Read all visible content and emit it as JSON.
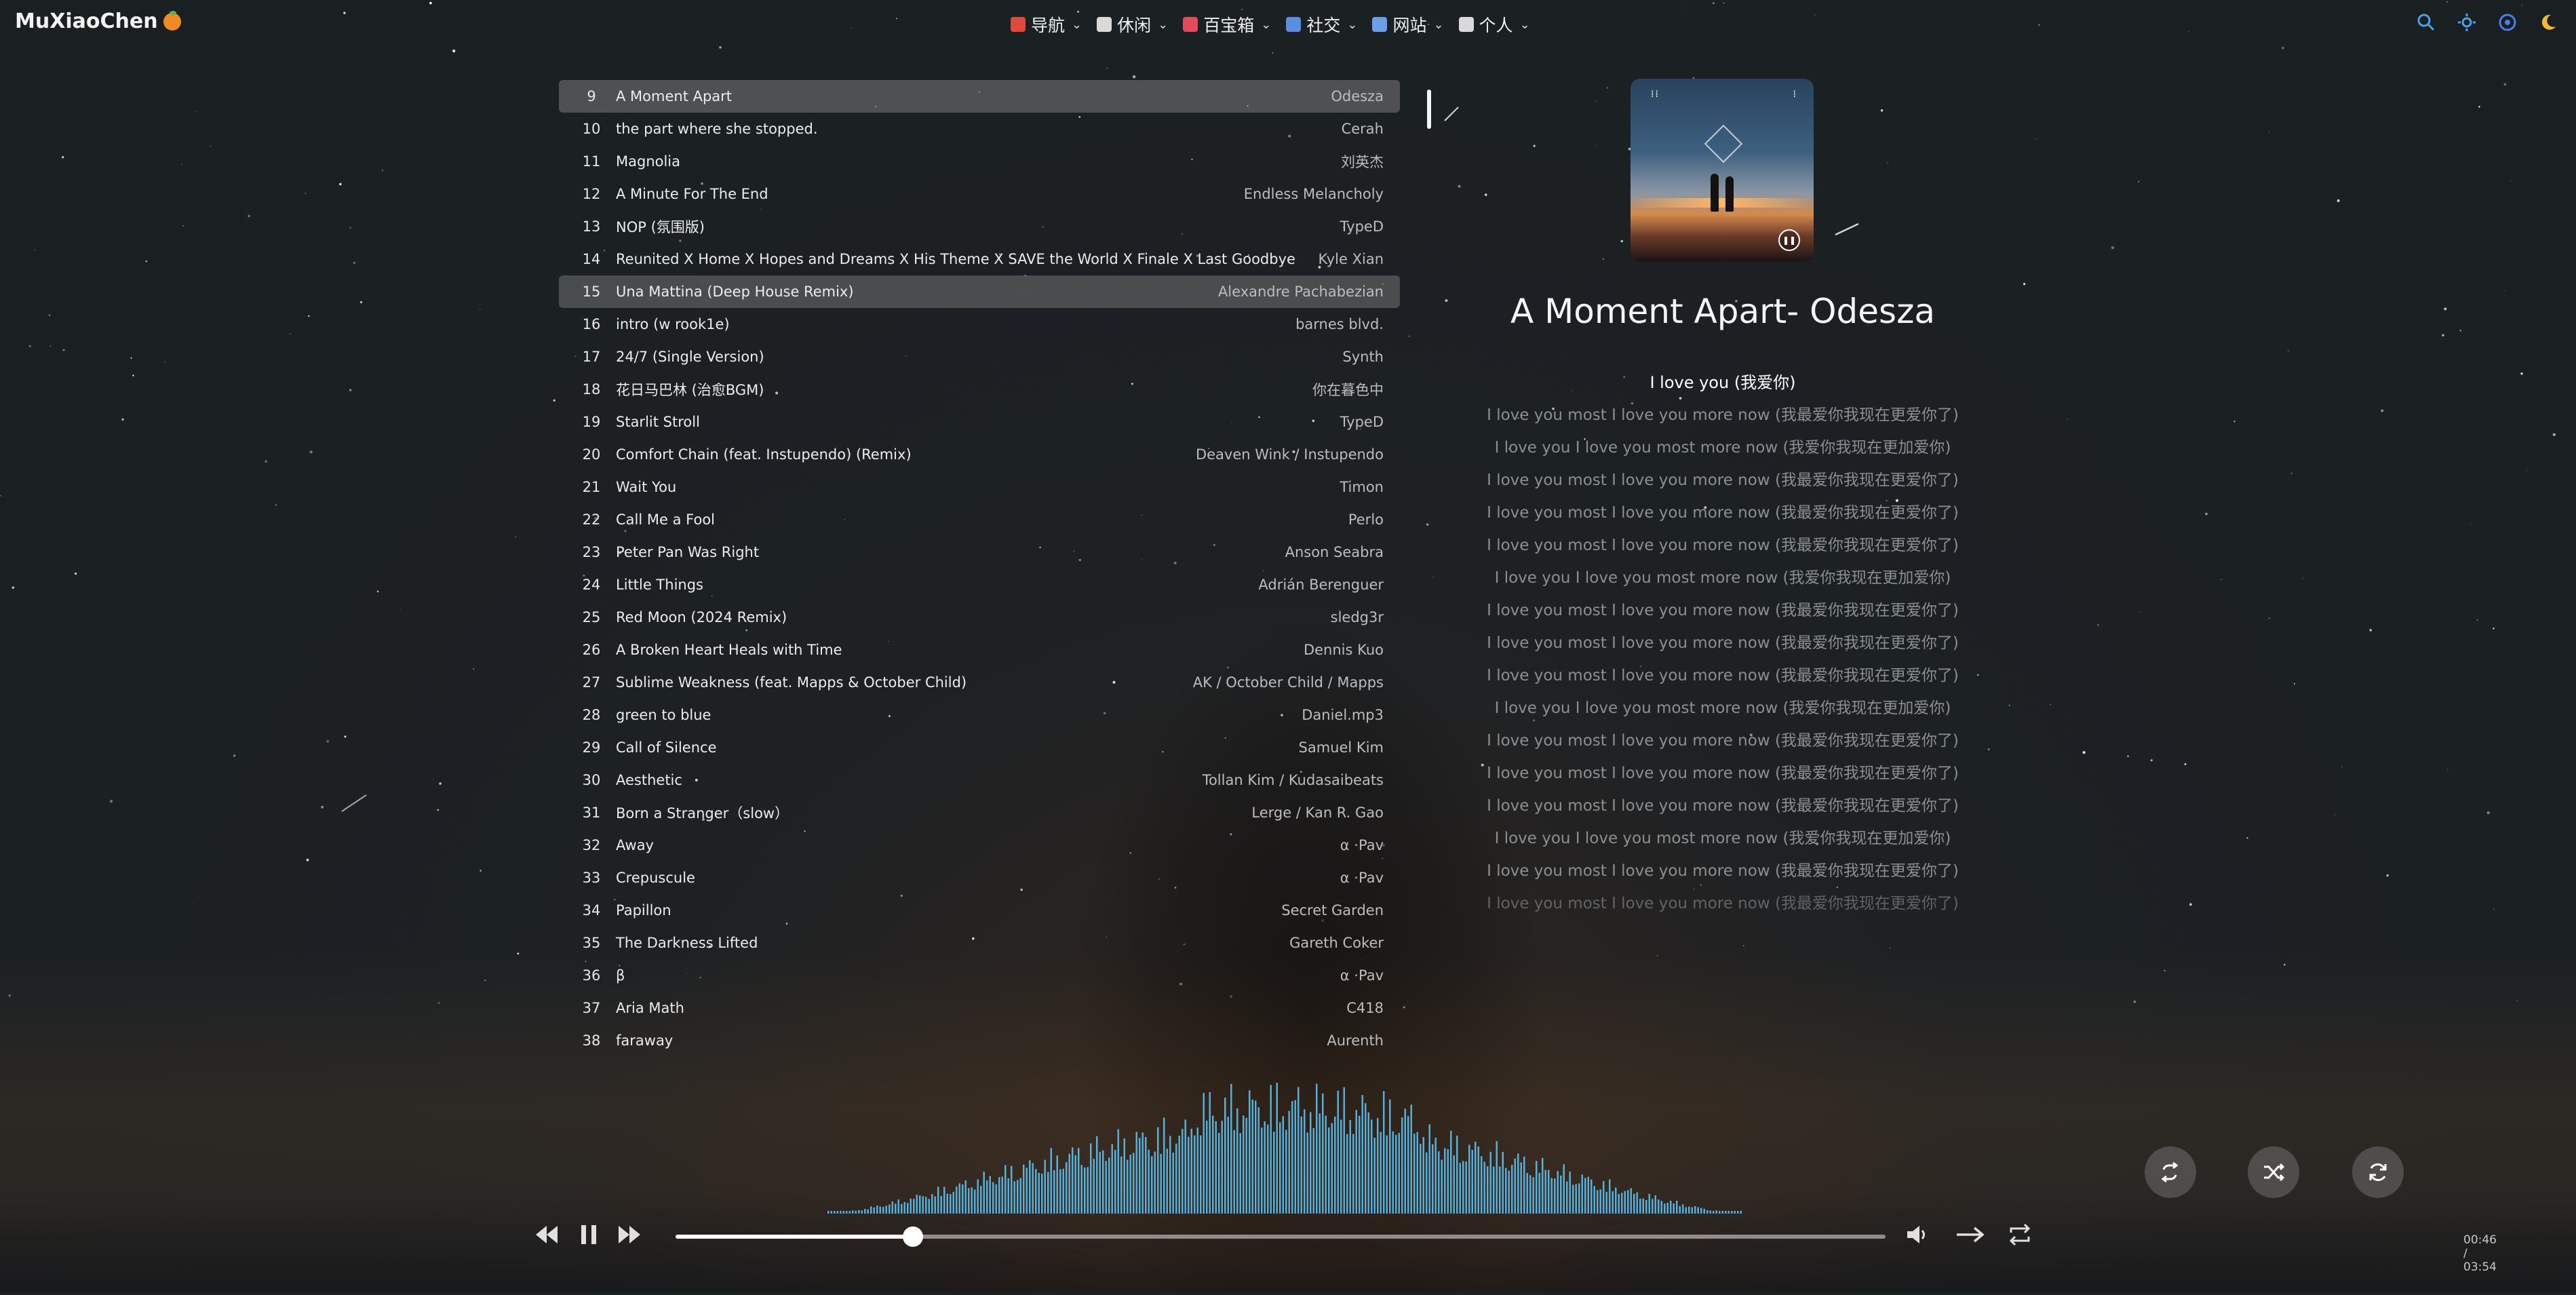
{
  "site": {
    "logo_text": "MuXiaoChen"
  },
  "nav": [
    {
      "label": "导航",
      "icon": "navigation-icon",
      "color": "#e04a3a"
    },
    {
      "label": "休闲",
      "icon": "coffee-icon",
      "color": "#d9d9d9"
    },
    {
      "label": "百宝箱",
      "icon": "gift-icon",
      "color": "#e24b5b"
    },
    {
      "label": "社交",
      "icon": "chat-icon",
      "color": "#5a8fe0"
    },
    {
      "label": "网站",
      "icon": "website-icon",
      "color": "#6aa0e8"
    },
    {
      "label": "个人",
      "icon": "notebook-icon",
      "color": "#d9d9d9"
    }
  ],
  "top_icons": [
    "search-icon",
    "theme-icon",
    "settings-icon",
    "moon-icon"
  ],
  "playlist": [
    {
      "num": "9",
      "title": "A Moment Apart",
      "artist": "Odesza",
      "state": "active"
    },
    {
      "num": "10",
      "title": "the part where she stopped.",
      "artist": "Cerah"
    },
    {
      "num": "11",
      "title": "Magnolia",
      "artist": "刘英杰"
    },
    {
      "num": "12",
      "title": "A Minute For The End",
      "artist": "Endless Melancholy"
    },
    {
      "num": "13",
      "title": "NOP (氛围版)",
      "artist": "TypeD"
    },
    {
      "num": "14",
      "title": "Reunited X Home X Hopes and Dreams X His Theme X SAVE the World X Finale X Last Goodbye",
      "artist": "Kyle Xian"
    },
    {
      "num": "15",
      "title": "Una Mattina (Deep House Remix)",
      "artist": "Alexandre Pachabezian",
      "state": "hover"
    },
    {
      "num": "16",
      "title": "intro (w rook1e)",
      "artist": "barnes blvd."
    },
    {
      "num": "17",
      "title": "24/7 (Single Version)",
      "artist": "Synth"
    },
    {
      "num": "18",
      "title": "花日马巴林 (治愈BGM)",
      "artist": "你在暮色中"
    },
    {
      "num": "19",
      "title": "Starlit Stroll",
      "artist": "TypeD"
    },
    {
      "num": "20",
      "title": "Comfort Chain (feat. Instupendo) (Remix)",
      "artist": "Deaven Wink / Instupendo"
    },
    {
      "num": "21",
      "title": "Wait You",
      "artist": "Timon"
    },
    {
      "num": "22",
      "title": "Call Me a Fool",
      "artist": "Perlo"
    },
    {
      "num": "23",
      "title": "Peter Pan Was Right",
      "artist": "Anson Seabra"
    },
    {
      "num": "24",
      "title": "Little Things",
      "artist": "Adrián Berenguer"
    },
    {
      "num": "25",
      "title": "Red Moon (2024 Remix)",
      "artist": "sledg3r"
    },
    {
      "num": "26",
      "title": "A Broken Heart Heals with Time",
      "artist": "Dennis Kuo"
    },
    {
      "num": "27",
      "title": "Sublime Weakness (feat. Mapps & October Child)",
      "artist": "AK / October Child / Mapps"
    },
    {
      "num": "28",
      "title": "green to blue",
      "artist": "Daniel.mp3"
    },
    {
      "num": "29",
      "title": "Call of Silence",
      "artist": "Samuel Kim"
    },
    {
      "num": "30",
      "title": "Aesthetic",
      "artist": "Tollan Kim / Kudasaibeats"
    },
    {
      "num": "31",
      "title": "Born a Stranger（slow）",
      "artist": "Lerge / Kan R. Gao"
    },
    {
      "num": "32",
      "title": "Away",
      "artist": "α ·Pav"
    },
    {
      "num": "33",
      "title": "Crepuscule",
      "artist": "α ·Pav"
    },
    {
      "num": "34",
      "title": "Papillon",
      "artist": "Secret Garden"
    },
    {
      "num": "35",
      "title": "The Darkness Lifted",
      "artist": "Gareth Coker"
    },
    {
      "num": "36",
      "title": "β",
      "artist": "α ·Pav"
    },
    {
      "num": "37",
      "title": "Aria Math",
      "artist": "C418"
    },
    {
      "num": "38",
      "title": "faraway",
      "artist": "Aurenth"
    }
  ],
  "now_playing": {
    "title": "A Moment Apart- Odesza",
    "current_lyric": "I love you (我爱你)",
    "lyrics": [
      "I love you most I love you more now (我最爱你我现在更爱你了)",
      "I love you I love you most more now (我爱你我现在更加爱你)",
      "I love you most I love you more now (我最爱你我现在更爱你了)",
      "I love you most I love you more now (我最爱你我现在更爱你了)",
      "I love you most I love you more now (我最爱你我现在更爱你了)",
      "I love you I love you most more now (我爱你我现在更加爱你)",
      "I love you most I love you more now (我最爱你我现在更爱你了)",
      "I love you most I love you more now (我最爱你我现在更爱你了)",
      "I love you most I love you more now (我最爱你我现在更爱你了)",
      "I love you I love you most more now (我爱你我现在更加爱你)",
      "I love you most I love you more now (我最爱你我现在更爱你了)",
      "I love you most I love you more now (我最爱你我现在更爱你了)",
      "I love you most I love you more now (我最爱你我现在更爱你了)",
      "I love you I love you most more now (我爱你我现在更加爱你)",
      "I love you most I love you more now (我最爱你我现在更爱你了)",
      "I love you most I love you more now (我最爱你我现在更爱你了)"
    ]
  },
  "player": {
    "time": "00:46 / 03:54",
    "progress": 0.196,
    "buttons": [
      "previous-icon",
      "pause-icon",
      "next-icon",
      "volume-icon",
      "order-icon",
      "loop-icon"
    ]
  },
  "mode_buttons": [
    "repeat-icon",
    "shuffle-icon",
    "refresh-icon"
  ],
  "colors": {
    "accent": "#4aa3e8",
    "visualizer": "#5bc0ef"
  }
}
